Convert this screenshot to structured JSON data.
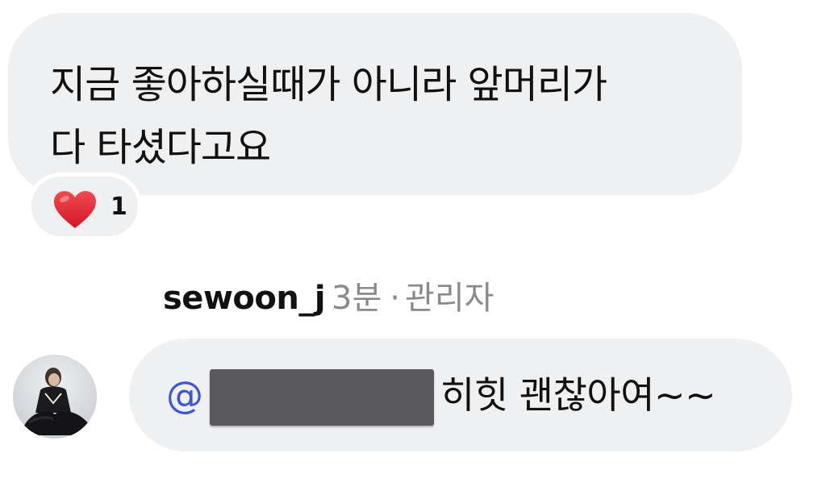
{
  "comment": {
    "text": "지금 좋아하실때가 아니라 앞머리가\n다 타셨다고요",
    "reaction": {
      "icon": "heart-icon",
      "emoji_color": "#e8202f",
      "count": "1"
    }
  },
  "reply": {
    "username": "sewoon_j",
    "time": "3분",
    "separator": "·",
    "role": "관리자",
    "avatar_icon": "user-avatar",
    "mention_prefix": "@",
    "mention_redacted": true,
    "text": "히힛 괜찮아여~~"
  },
  "colors": {
    "bubble": "#eff0f2",
    "mention": "#3d55d6",
    "meta_gray": "#8a8a8e",
    "redaction": "#5a5a5c"
  }
}
